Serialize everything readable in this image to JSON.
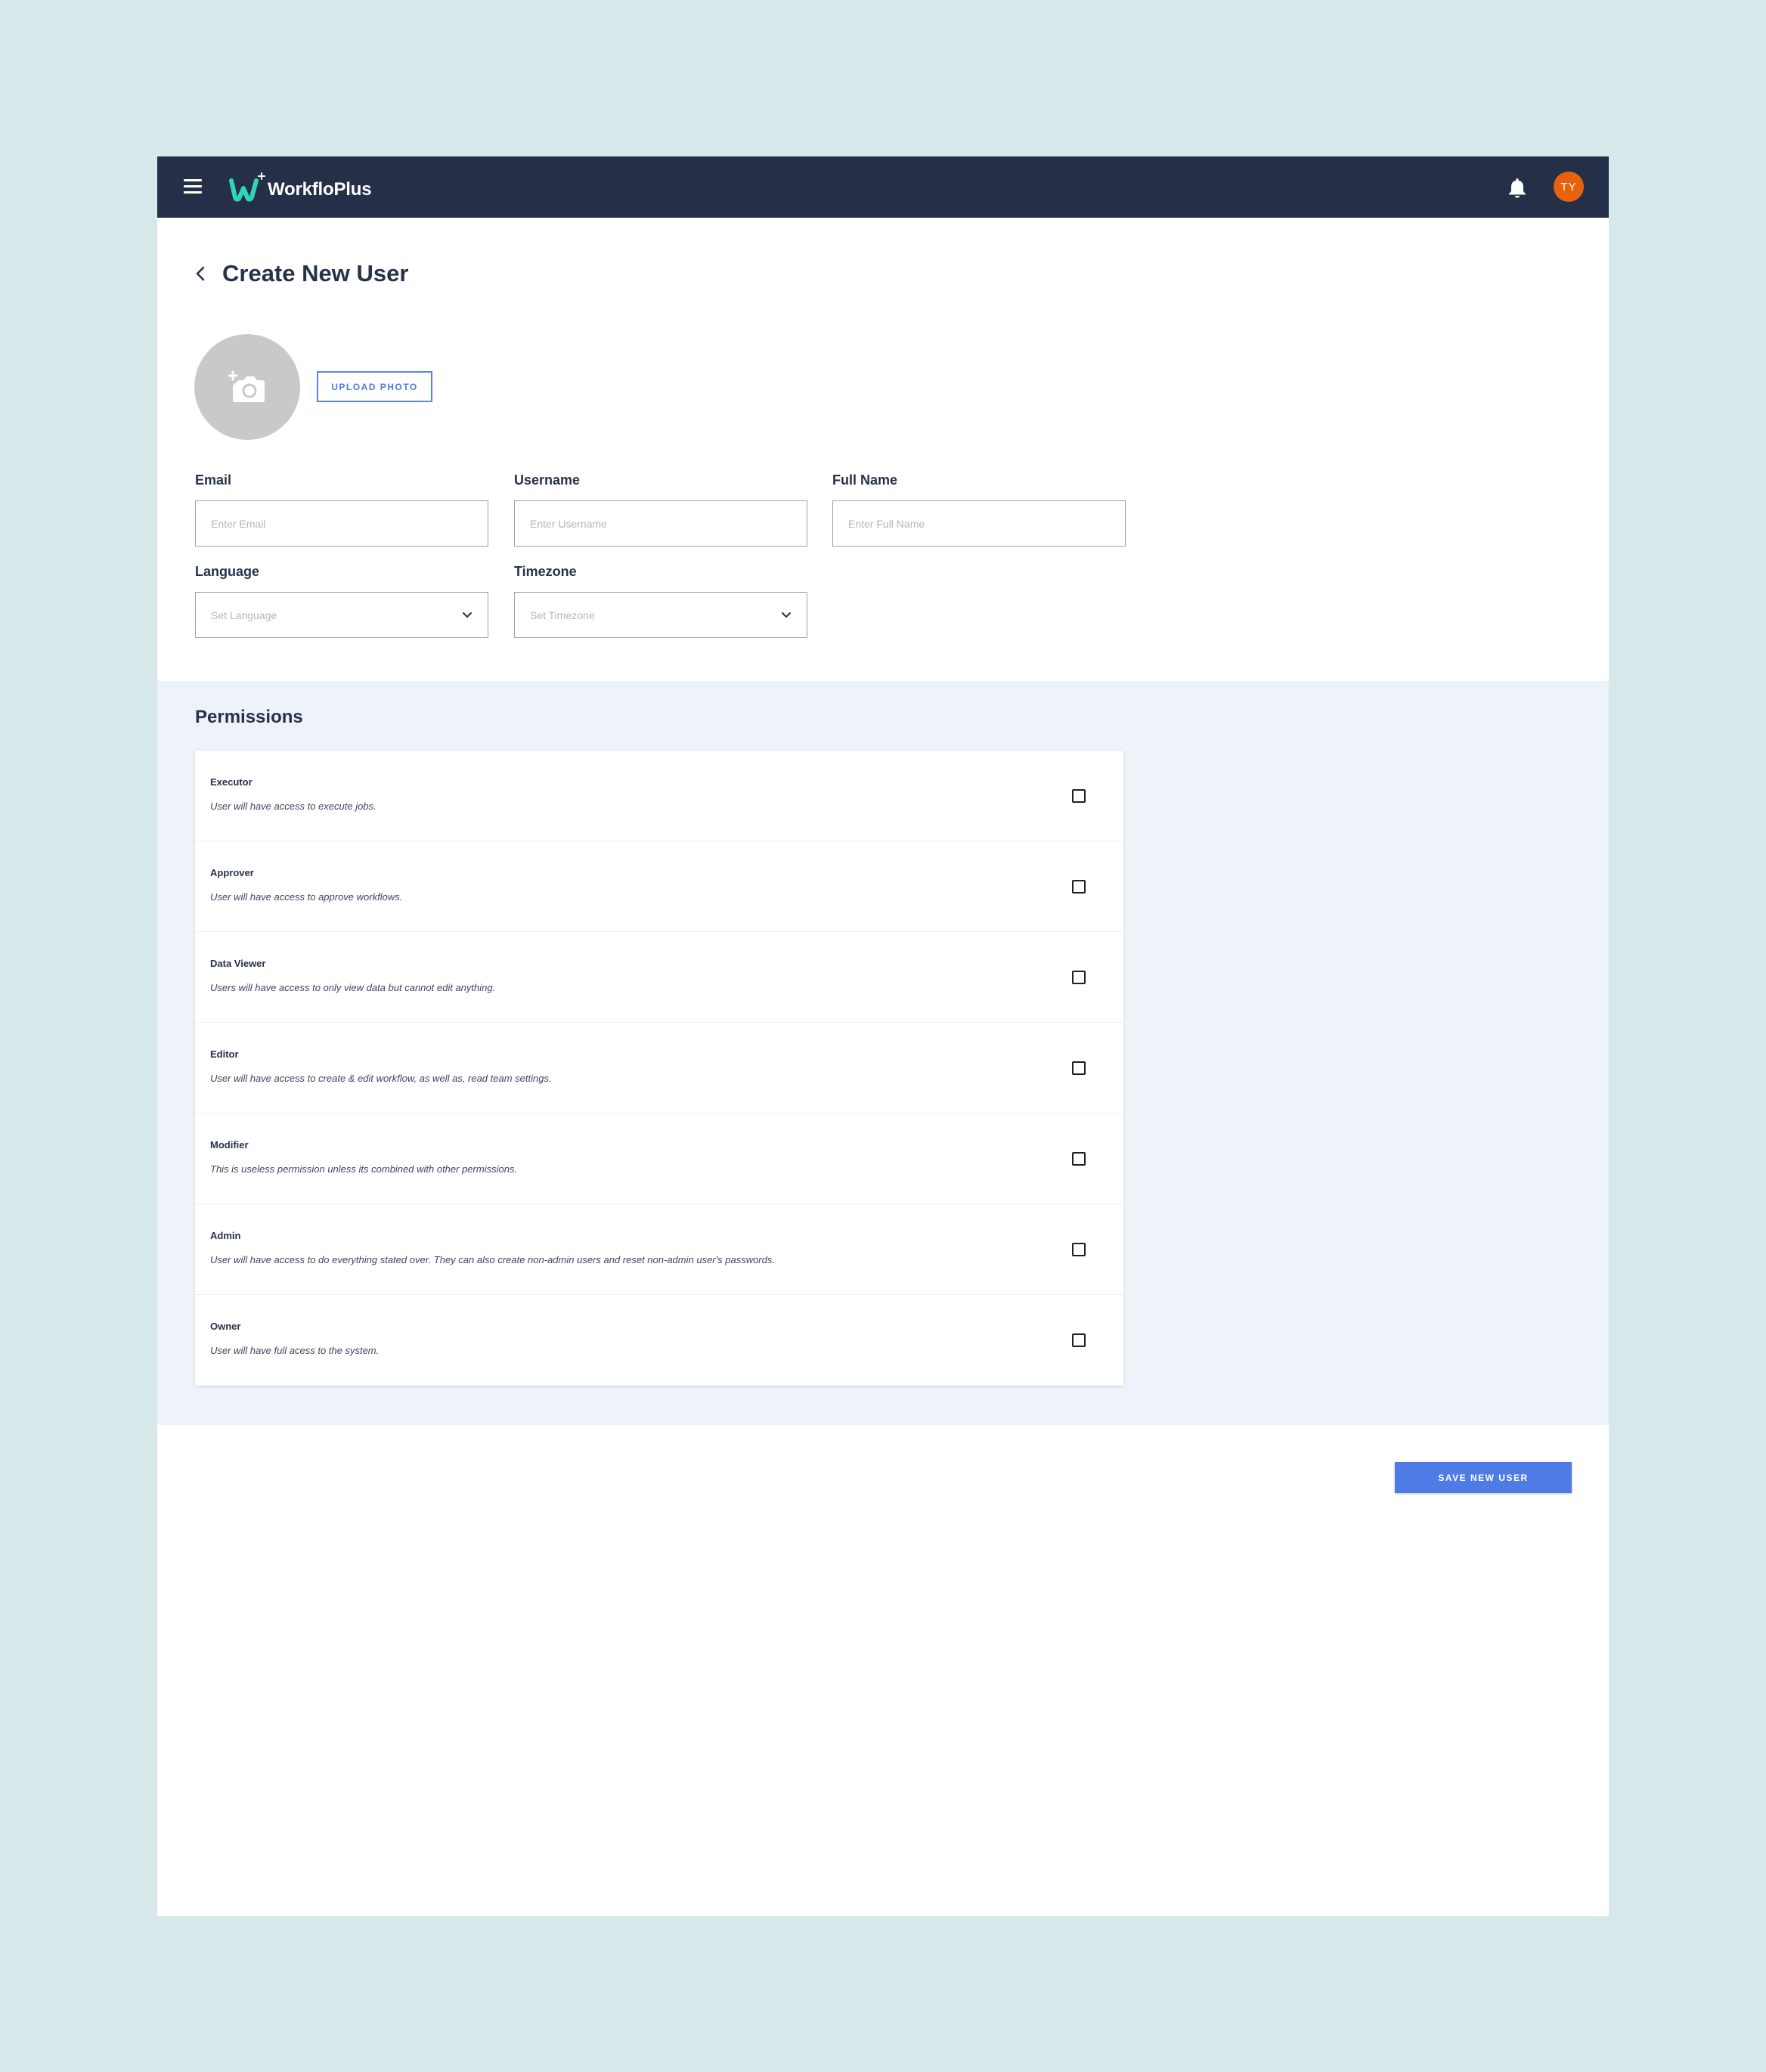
{
  "header": {
    "app_name": "WorkfloPlus",
    "user_initials": "TY",
    "colors": {
      "bar": "#262f48",
      "logo_accent": "#2fd6b4",
      "avatar": "#e8620d"
    }
  },
  "page": {
    "title": "Create New User"
  },
  "photo": {
    "upload_label": "UPLOAD PHOTO"
  },
  "form": {
    "email": {
      "label": "Email",
      "placeholder": "Enter Email"
    },
    "username": {
      "label": "Username",
      "placeholder": "Enter Username"
    },
    "full_name": {
      "label": "Full Name",
      "placeholder": "Enter Full Name"
    },
    "language": {
      "label": "Language",
      "placeholder": "Set Language"
    },
    "timezone": {
      "label": "Timezone",
      "placeholder": "Set Timezone"
    }
  },
  "permissions": {
    "title": "Permissions",
    "items": [
      {
        "name": "Executor",
        "description": "User will have access to execute jobs."
      },
      {
        "name": "Approver",
        "description": "User will have access to approve workflows."
      },
      {
        "name": "Data Viewer",
        "description": "Users will have access to only view data but cannot edit anything."
      },
      {
        "name": "Editor",
        "description": "User will have access to create & edit workflow, as well as, read team settings."
      },
      {
        "name": "Modifier",
        "description": "This is useless permission unless its combined with other permissions."
      },
      {
        "name": "Admin",
        "description": "User will have access to do everything stated over. They can also create non-admin users and reset non-admin user's passwords."
      },
      {
        "name": "Owner",
        "description": "User will have full acess to the system."
      }
    ]
  },
  "actions": {
    "save_label": "SAVE NEW USER",
    "save_color": "#4f7be6"
  }
}
